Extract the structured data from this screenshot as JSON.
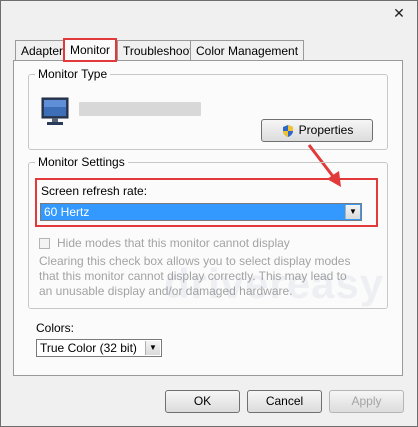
{
  "window": {
    "close_icon": "close-icon"
  },
  "tabs": [
    {
      "label": "Adapter",
      "active": false
    },
    {
      "label": "Monitor",
      "active": true
    },
    {
      "label": "Troubleshoot",
      "active": false
    },
    {
      "label": "Color Management",
      "active": false
    }
  ],
  "monitor_type": {
    "group_label": "Monitor Type",
    "properties_label": "Properties"
  },
  "monitor_settings": {
    "group_label": "Monitor Settings",
    "refresh_label": "Screen refresh rate:",
    "refresh_value": "60 Hertz",
    "hide_modes_label": "Hide modes that this monitor cannot display",
    "hide_modes_checked": false,
    "description": "Clearing this check box allows you to select display modes that this monitor cannot display correctly. This may lead to an unusable display and/or damaged hardware."
  },
  "colors": {
    "label": "Colors:",
    "value": "True Color (32 bit)"
  },
  "footer": {
    "ok_label": "OK",
    "cancel_label": "Cancel",
    "apply_label": "Apply"
  },
  "watermark": "drivereasy",
  "accent_colors": {
    "highlight": "#e23a3a",
    "selection": "#3399ff"
  }
}
